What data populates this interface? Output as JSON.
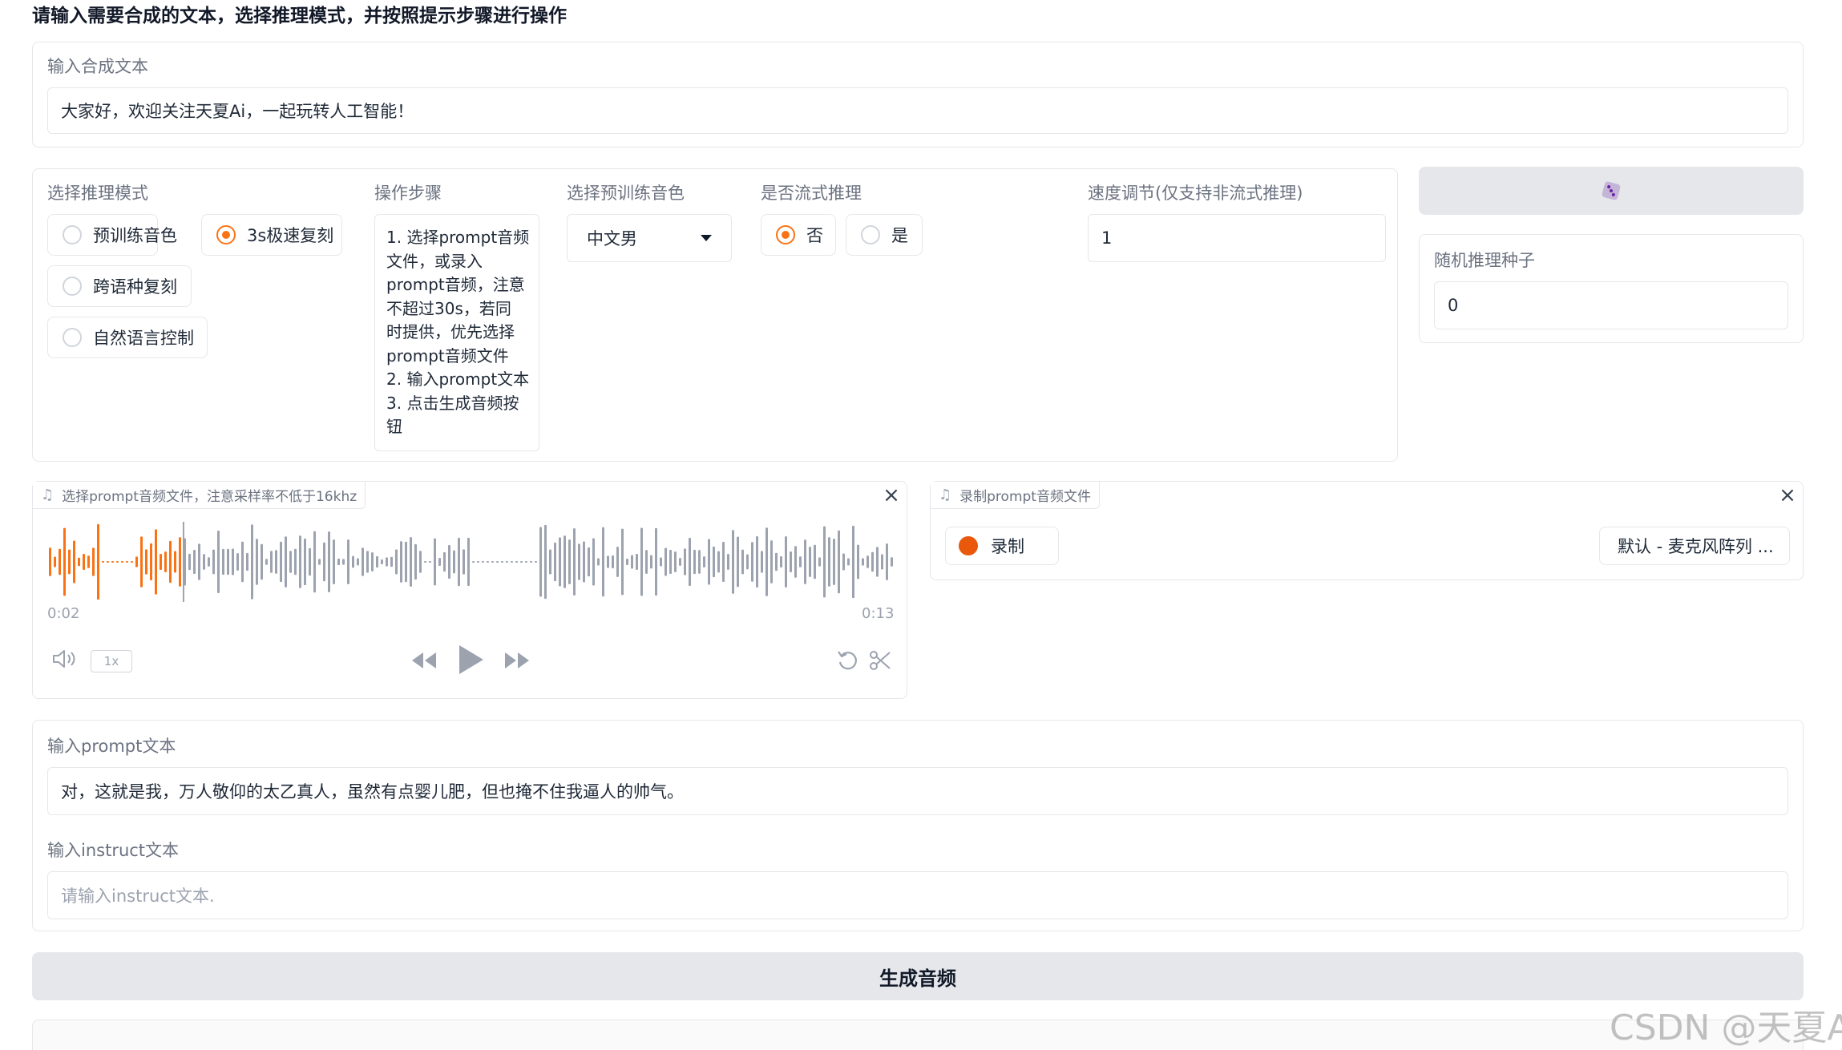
{
  "header": {
    "title": "请输入需要合成的文本，选择推理模式，并按照提示步骤进行操作"
  },
  "tts_text": {
    "label": "输入合成文本",
    "value": "大家好，欢迎关注天夏Ai，一起玩转人工智能！"
  },
  "mode": {
    "label": "选择推理模式",
    "options": [
      "预训练音色",
      "3s极速复刻",
      "跨语种复刻",
      "自然语言控制"
    ],
    "selected": "3s极速复刻"
  },
  "steps": {
    "label": "操作步骤",
    "lines": [
      "1. 选择prompt音频",
      "文件，或录入",
      "prompt音频，注意",
      "不超过30s，若同",
      "时提供，优先选择",
      "prompt音频文件",
      "2. 输入prompt文本",
      "3. 点击生成音频按",
      "钮"
    ]
  },
  "voice": {
    "label": "选择预训练音色",
    "value": "中文男"
  },
  "stream": {
    "label": "是否流式推理",
    "options": [
      "否",
      "是"
    ],
    "selected": "否"
  },
  "speed": {
    "label": "速度调节(仅支持非流式推理)",
    "value": "1"
  },
  "seed": {
    "dice_icon": "dice-icon",
    "label": "随机推理种子",
    "value": "0"
  },
  "upload_audio": {
    "label": "选择prompt音频文件，注意采样率不低于16khz",
    "current_time": "0:02",
    "duration": "0:13",
    "progress": 0.16,
    "speed_chip": "1x",
    "colors": {
      "played": "#f97316",
      "unplayed": "#9ca3af"
    }
  },
  "record_audio": {
    "label": "录制prompt音频文件",
    "record_label": "录制",
    "mic_label": "默认 - 麦克风阵列 ..."
  },
  "prompt_text": {
    "label": "输入prompt文本",
    "value": "对，这就是我，万人敬仰的太乙真人，虽然有点婴儿肥，但也掩不住我逼人的帅气。"
  },
  "instruct_text": {
    "label": "输入instruct文本",
    "placeholder": "请输入instruct文本."
  },
  "generate_button": {
    "label": "生成音频"
  },
  "watermark": "CSDN @天夏Ai"
}
